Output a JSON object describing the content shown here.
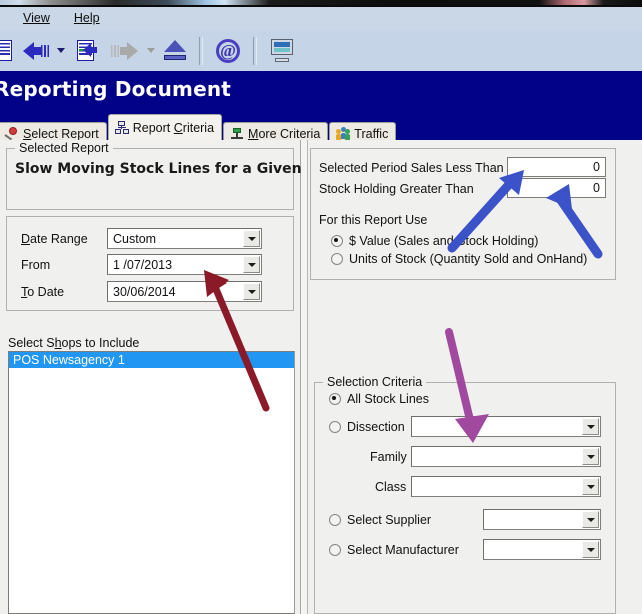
{
  "window": {
    "menu": [
      {
        "label": "View",
        "accel": "V"
      },
      {
        "label": "Help",
        "accel": "H"
      }
    ],
    "title": "Reporting Document"
  },
  "toolbar": {
    "items": [
      {
        "name": "document-lines-icon",
        "label": ""
      },
      {
        "name": "back-arrow-icon",
        "label": ""
      },
      {
        "name": "back-arrow-dropdown-caret-icon",
        "label": ""
      },
      {
        "name": "document-insert-icon",
        "label": ""
      },
      {
        "name": "forward-arrow-icon-disabled",
        "label": ""
      },
      {
        "name": "forward-arrow-dropdown-caret-icon-disabled",
        "label": ""
      },
      {
        "name": "eject-icon",
        "label": ""
      },
      {
        "name": "email-at-icon",
        "label": ""
      },
      {
        "name": "monitor-preview-icon",
        "label": ""
      }
    ]
  },
  "tabs": [
    {
      "label": "Select Report",
      "icon": "pushpin-icon",
      "active": false
    },
    {
      "label": "Report Criteria",
      "icon": "org-chart-icon",
      "active": true
    },
    {
      "label": "More Criteria",
      "icon": "tool-icon",
      "active": false
    },
    {
      "label": "Traffic",
      "icon": "people-icon",
      "active": false
    }
  ],
  "selected_report": {
    "legend": "Selected Report",
    "name": "Slow Moving Stock Lines for a Given Period"
  },
  "date_panel": {
    "date_range_label": "Date Range",
    "date_range_value": "Custom",
    "from_label": "From",
    "from_value": "1 /07/2013",
    "to_date_label": "To Date",
    "to_date_value": "30/06/2014"
  },
  "shops": {
    "label": "Select Shops to Include",
    "items": [
      {
        "label": "POS Newsagency 1",
        "selected": true
      }
    ]
  },
  "thresholds": {
    "sales_less_than_label": "Selected Period Sales Less Than",
    "sales_less_than_value": "0",
    "stock_holding_greater_than_label": "Stock Holding Greater Than",
    "stock_holding_greater_than_value": "0",
    "for_this_report_use_label": "For this Report Use",
    "options": [
      {
        "label": "$ Value (Sales and Stock Holding)",
        "selected": true
      },
      {
        "label": "Units of Stock (Quantity Sold and OnHand)",
        "selected": false
      }
    ]
  },
  "selection_criteria": {
    "legend": "Selection Criteria",
    "all_stock_lines": {
      "label": "All Stock Lines",
      "selected": true
    },
    "dissection": {
      "label": "Dissection",
      "selected": false,
      "value": ""
    },
    "family": {
      "label": "Family",
      "value": ""
    },
    "class": {
      "label": "Class",
      "value": ""
    },
    "select_supplier": {
      "label": "Select Supplier",
      "selected": false,
      "value": ""
    },
    "select_manufacturer": {
      "label": "Select Manufacturer",
      "selected": false,
      "value": ""
    }
  },
  "annotations": [
    {
      "name": "red-arrow-to-date-fields",
      "color": "#8B1A28"
    },
    {
      "name": "blue-arrow-to-sales-less-than-field",
      "color": "#3B52C8"
    },
    {
      "name": "blue-arrow-to-stock-holding-field",
      "color": "#3B52C8"
    },
    {
      "name": "purple-arrow-to-dissection-combo",
      "color": "#A0499E"
    }
  ],
  "colors": {
    "title_band": "#020288",
    "menubar": "#c9d7e7",
    "toolbar": "#c5d4e6",
    "panel": "#f0f0ee",
    "selection_highlight": "#2196f3",
    "red_arrow": "#8B1A28",
    "blue_arrow": "#3B52C8",
    "purple_arrow": "#A0499E"
  }
}
